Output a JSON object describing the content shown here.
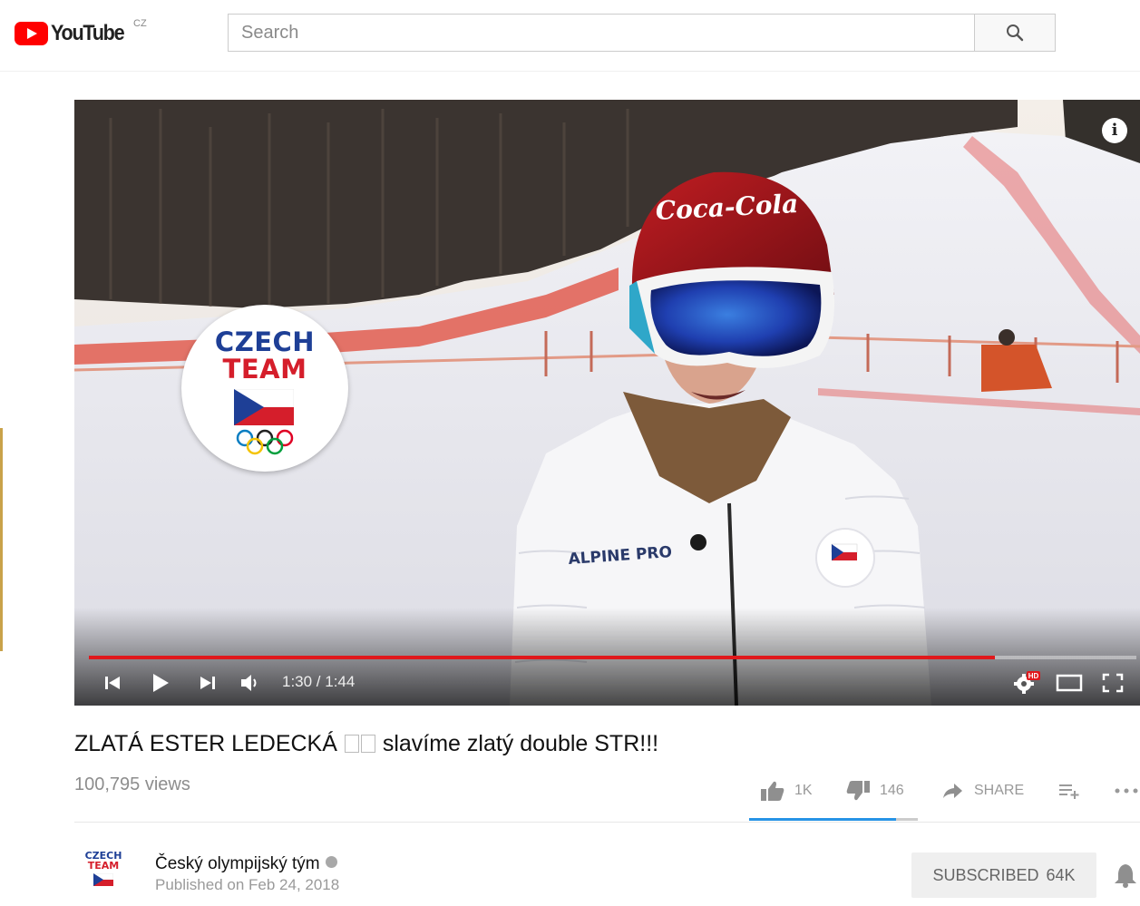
{
  "masthead": {
    "logo_word": "YouTube",
    "logo_region": "CZ",
    "search_placeholder": "Search",
    "search_icon": "search-icon",
    "brand_color": "#ff0000"
  },
  "player": {
    "overlay_badge": {
      "line1": "CZECH",
      "line2": "TEAM"
    },
    "helmet_text": "Coca-Cola",
    "jacket_text": "ALPINE PRO",
    "current_time": "1:30",
    "duration": "1:44",
    "time_display": "1:30 / 1:44",
    "progress_fraction": 0.865,
    "progress_color": "#e0181c",
    "hd_badge": "HD",
    "icons": [
      "previous-icon",
      "play-icon",
      "next-icon",
      "volume-icon",
      "settings-icon",
      "theater-mode-icon",
      "fullscreen-icon",
      "info-icon"
    ]
  },
  "video": {
    "title_before": "ZLATÁ ESTER LEDECKÁ",
    "title_after": "slavíme zlatý double STR!!!",
    "views": "100,795 views",
    "likes": "1K",
    "dislikes": "146",
    "share_label": "SHARE",
    "like_fraction": 0.87,
    "sentiment_color": "#2793e6"
  },
  "channel": {
    "avatar_line1": "CZECH",
    "avatar_line2": "TEAM",
    "name": "Český olympijský tým",
    "published": "Published on Feb 24, 2018",
    "subscribe_label": "SUBSCRIBED",
    "subscriber_count": "64K"
  }
}
